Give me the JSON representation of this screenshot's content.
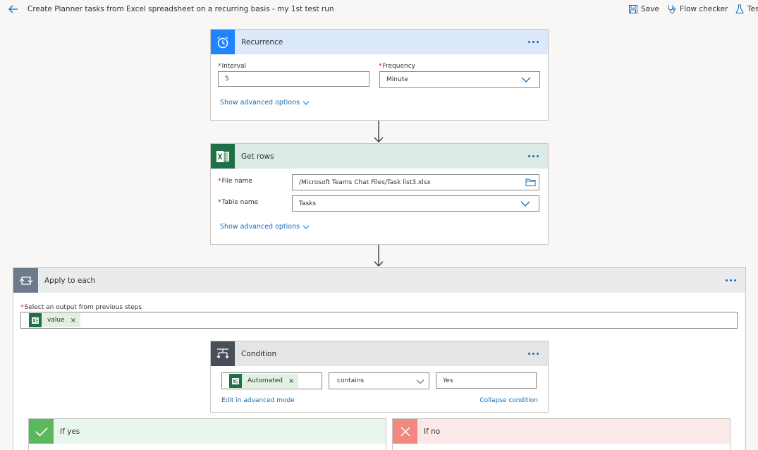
{
  "header": {
    "title": "Create Planner tasks from Excel spreadsheet on a recurring basis - my 1st test run",
    "save_label": "Save",
    "flow_checker_label": "Flow checker",
    "test_label": "Tes"
  },
  "recurrence": {
    "title": "Recurrence",
    "interval_label": "Interval",
    "interval_value": "5",
    "frequency_label": "Frequency",
    "frequency_value": "Minute",
    "advanced_label": "Show advanced options"
  },
  "get_rows": {
    "title": "Get rows",
    "file_label": "File name",
    "file_value": "/Microsoft Teams Chat Files/Task list3.xlsx",
    "table_label": "Table name",
    "table_value": "Tasks",
    "advanced_label": "Show advanced options"
  },
  "apply_each": {
    "title": "Apply to each",
    "select_label": "Select an output from previous steps",
    "token_label": "value"
  },
  "condition": {
    "title": "Condition",
    "left_token": "Automated",
    "operator": "contains",
    "right_value": "Yes",
    "advanced_mode_label": "Edit in advanced mode",
    "collapse_label": "Collapse condition"
  },
  "branches": {
    "yes_label": "If yes",
    "no_label": "If no"
  },
  "colors": {
    "recurrence_header": "#dce9fa",
    "recurrence_icon": "#1f85ff",
    "excel_header": "#dbeae2",
    "excel_icon": "#1e7145",
    "apply_header": "#eaebed",
    "apply_icon": "#6c7a89",
    "condition_header": "#e5e5e5",
    "condition_icon": "#484f58",
    "yes_header": "#e9f6ec",
    "yes_icon": "#5cb85c",
    "no_header": "#fde8e8",
    "no_icon": "#f0887e"
  }
}
